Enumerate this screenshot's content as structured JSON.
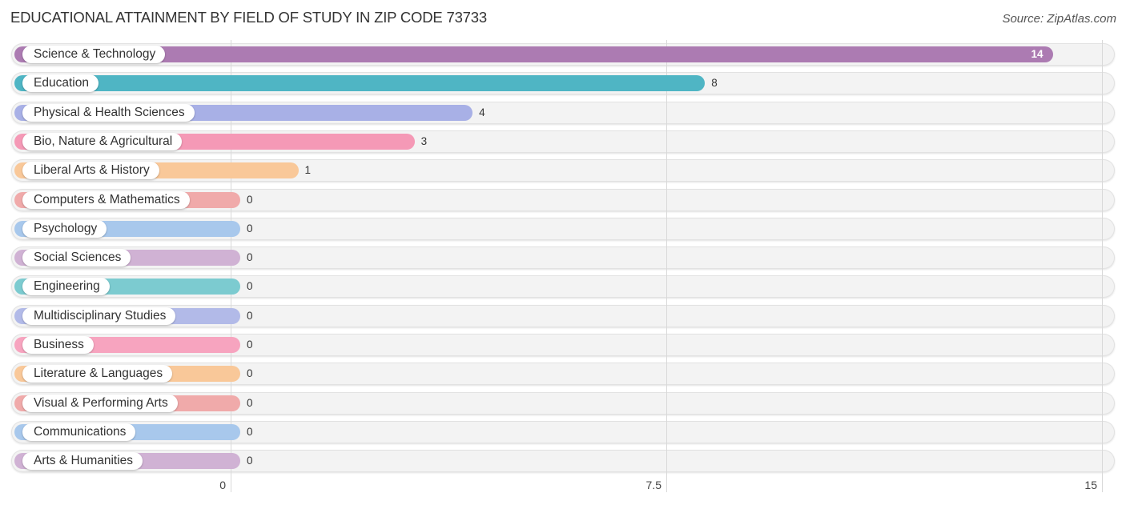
{
  "header": {
    "title": "EDUCATIONAL ATTAINMENT BY FIELD OF STUDY IN ZIP CODE 73733",
    "source": "Source: ZipAtlas.com"
  },
  "chart_data": {
    "type": "bar",
    "orientation": "horizontal",
    "title": "EDUCATIONAL ATTAINMENT BY FIELD OF STUDY IN ZIP CODE 73733",
    "source": "Source: ZipAtlas.com",
    "xlabel": "",
    "ylabel": "",
    "xlim": [
      0,
      15
    ],
    "x_ticks": [
      0,
      7.5,
      15
    ],
    "x_tick_labels": [
      "0",
      "7.5",
      "15"
    ],
    "grid": true,
    "categories": [
      "Science & Technology",
      "Education",
      "Physical & Health Sciences",
      "Bio, Nature & Agricultural",
      "Liberal Arts & History",
      "Computers & Mathematics",
      "Psychology",
      "Social Sciences",
      "Engineering",
      "Multidisciplinary Studies",
      "Business",
      "Literature & Languages",
      "Visual & Performing Arts",
      "Communications",
      "Arts & Humanities"
    ],
    "values": [
      14,
      8,
      4,
      3,
      1,
      0,
      0,
      0,
      0,
      0,
      0,
      0,
      0,
      0,
      0
    ],
    "value_labels": [
      "14",
      "8",
      "4",
      "3",
      "1",
      "0",
      "0",
      "0",
      "0",
      "0",
      "0",
      "0",
      "0",
      "0",
      "0"
    ],
    "colors": [
      "#ac7bb2",
      "#4fb5c4",
      "#a8b0e6",
      "#f599b6",
      "#f9c899",
      "#f0aaaa",
      "#a8c8ec",
      "#d0b2d4",
      "#7ccbd0",
      "#b2bae8",
      "#f7a4bf",
      "#f9c899",
      "#f0aaaa",
      "#a8c8ec",
      "#d0b2d4"
    ]
  }
}
